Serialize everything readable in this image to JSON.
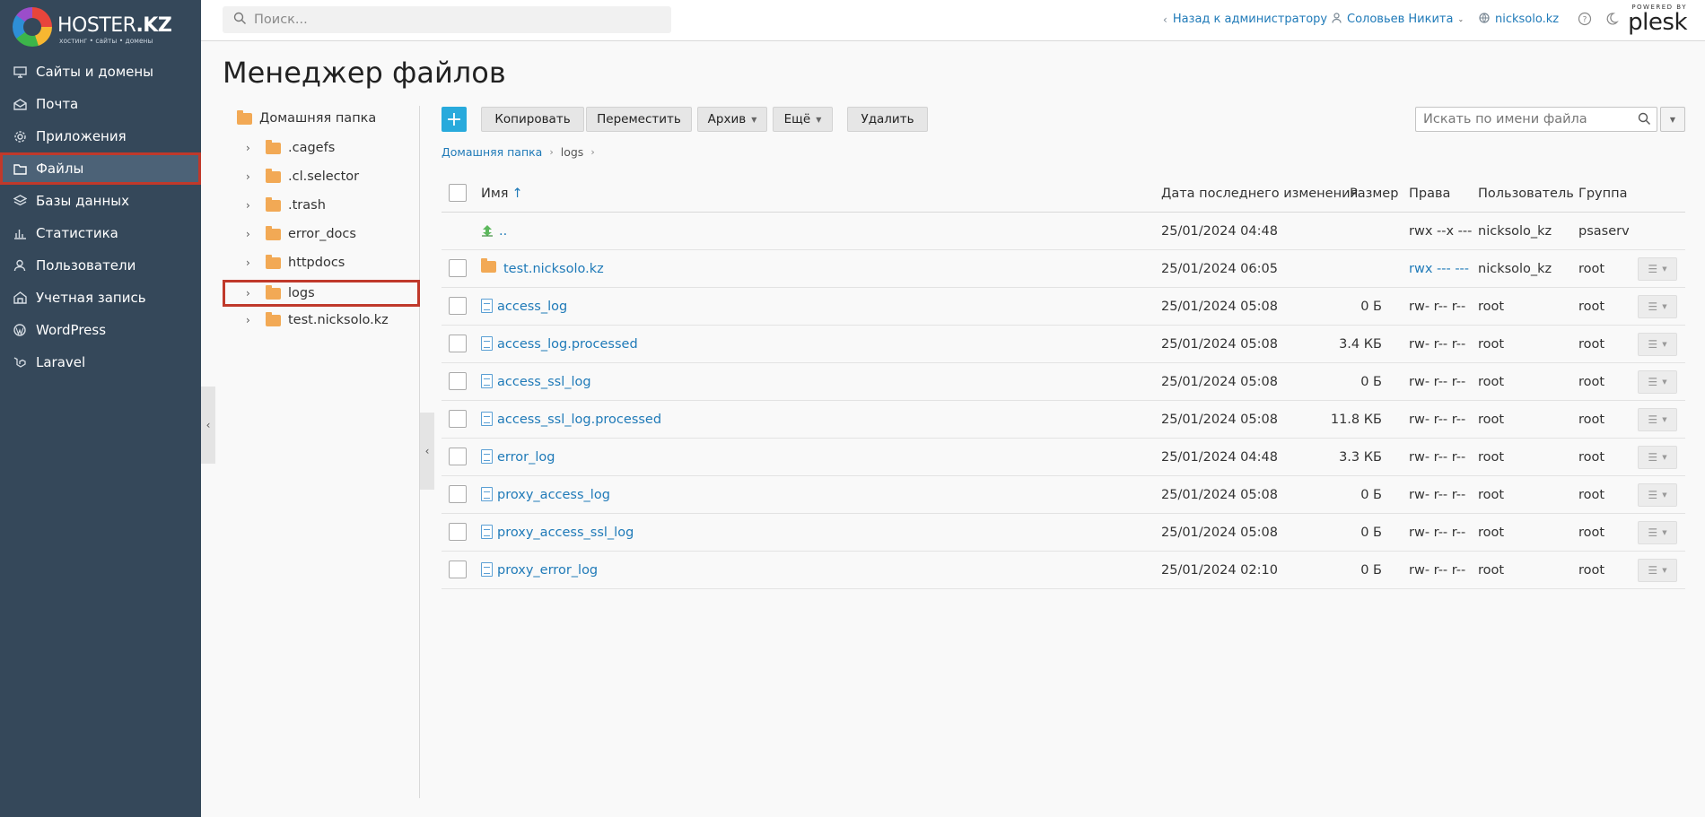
{
  "sidebar": {
    "logo": {
      "brand_main": "HOSTER",
      "brand_suffix": ".KZ",
      "tagline": "хостинг • сайты • домены"
    },
    "items": [
      {
        "label": "Сайты и домены",
        "icon": "monitor-icon"
      },
      {
        "label": "Почта",
        "icon": "mail-icon"
      },
      {
        "label": "Приложения",
        "icon": "gear-icon"
      },
      {
        "label": "Файлы",
        "icon": "folder-icon",
        "active": true
      },
      {
        "label": "Базы данных",
        "icon": "layers-icon"
      },
      {
        "label": "Статистика",
        "icon": "bar-chart-icon"
      },
      {
        "label": "Пользователи",
        "icon": "user-icon"
      },
      {
        "label": "Учетная запись",
        "icon": "account-icon"
      },
      {
        "label": "WordPress",
        "icon": "wordpress-icon"
      },
      {
        "label": "Laravel",
        "icon": "laravel-icon"
      }
    ]
  },
  "header": {
    "search_placeholder": "Поиск...",
    "back_link": "Назад к администратору",
    "user": "Соловьев Никита",
    "domain": "nicksolo.kz",
    "powered_by": "POWERED BY",
    "plesk": "plesk"
  },
  "page": {
    "title": "Менеджер файлов"
  },
  "tree": {
    "root": "Домашняя папка",
    "items": [
      ".cagefs",
      ".cl.selector",
      ".trash",
      "error_docs",
      "httpdocs",
      "logs",
      "test.nicksolo.kz"
    ],
    "selected": "logs"
  },
  "toolbar": {
    "add": "+",
    "copy": "Копировать",
    "move": "Переместить",
    "archive": "Архив",
    "more": "Ещё",
    "delete": "Удалить",
    "search_placeholder": "Искать по имени файла"
  },
  "breadcrumb": [
    "Домашняя папка",
    "logs"
  ],
  "table": {
    "headers": {
      "name": "Имя",
      "modified": "Дата последнего изменения",
      "size": "Размер",
      "perms": "Права",
      "user": "Пользователь",
      "group": "Группа"
    },
    "rows": [
      {
        "name": "..",
        "type": "up",
        "modified": "25/01/2024 04:48",
        "size": "",
        "perms": "rwx --x ---",
        "user": "nicksolo_kz",
        "group": "psaserv"
      },
      {
        "name": "test.nicksolo.kz",
        "type": "folder",
        "modified": "25/01/2024 06:05",
        "size": "",
        "perms": "rwx --- ---",
        "user": "nicksolo_kz",
        "group": "root"
      },
      {
        "name": "access_log",
        "type": "file",
        "modified": "25/01/2024 05:08",
        "size": "0 Б",
        "perms": "rw- r-- r--",
        "user": "root",
        "group": "root"
      },
      {
        "name": "access_log.processed",
        "type": "file",
        "modified": "25/01/2024 05:08",
        "size": "3.4 КБ",
        "perms": "rw- r-- r--",
        "user": "root",
        "group": "root"
      },
      {
        "name": "access_ssl_log",
        "type": "file",
        "modified": "25/01/2024 05:08",
        "size": "0 Б",
        "perms": "rw- r-- r--",
        "user": "root",
        "group": "root"
      },
      {
        "name": "access_ssl_log.processed",
        "type": "file",
        "modified": "25/01/2024 05:08",
        "size": "11.8 КБ",
        "perms": "rw- r-- r--",
        "user": "root",
        "group": "root"
      },
      {
        "name": "error_log",
        "type": "file",
        "modified": "25/01/2024 04:48",
        "size": "3.3 КБ",
        "perms": "rw- r-- r--",
        "user": "root",
        "group": "root"
      },
      {
        "name": "proxy_access_log",
        "type": "file",
        "modified": "25/01/2024 05:08",
        "size": "0 Б",
        "perms": "rw- r-- r--",
        "user": "root",
        "group": "root"
      },
      {
        "name": "proxy_access_ssl_log",
        "type": "file",
        "modified": "25/01/2024 05:08",
        "size": "0 Б",
        "perms": "rw- r-- r--",
        "user": "root",
        "group": "root"
      },
      {
        "name": "proxy_error_log",
        "type": "file",
        "modified": "25/01/2024 02:10",
        "size": "0 Б",
        "perms": "rw- r-- r--",
        "user": "root",
        "group": "root"
      }
    ]
  },
  "colors": {
    "sidebar": "#35485a",
    "accent": "#28aadc",
    "link": "#1f7ab8",
    "highlight": "#c0392b",
    "folder": "#f2a955"
  }
}
